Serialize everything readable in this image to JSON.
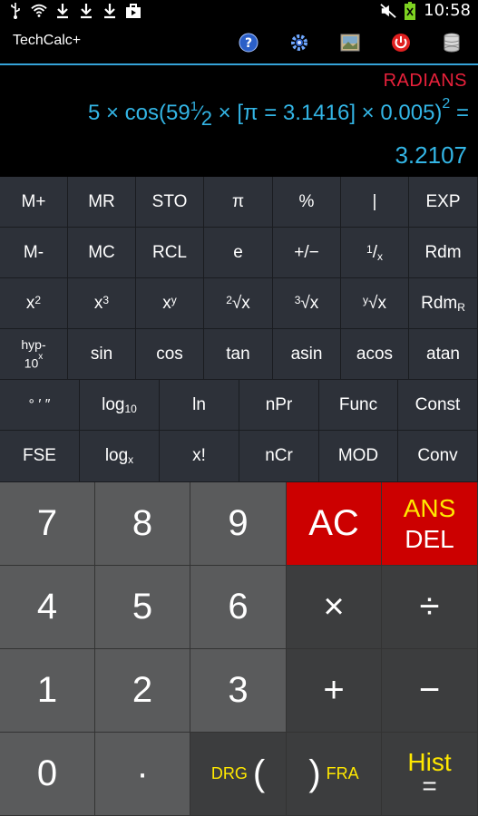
{
  "status_bar": {
    "time": "10:58",
    "left_icons": [
      "usb-icon",
      "wifi-icon",
      "download-icon",
      "download-icon",
      "download-icon",
      "shop-icon"
    ],
    "right_icons": [
      "mute-icon",
      "battery-icon"
    ]
  },
  "action_bar": {
    "title": "TechCalc+",
    "icons": [
      "help-icon",
      "settings-icon",
      "theme-icon",
      "power-icon",
      "storage-icon"
    ]
  },
  "display": {
    "mode": "RADIANS",
    "expression": {
      "prefix": "5 × cos(59",
      "frac_num": "1",
      "frac_slash": "⁄",
      "frac_den": "2",
      "middle": " × [π = 3.1416] × 0.005)",
      "exponent": "2",
      "suffix": " ="
    },
    "result": "3.2107"
  },
  "sci_keys": {
    "row1": [
      "M+",
      "MR",
      "STO",
      "π",
      "%",
      "|",
      "EXP"
    ],
    "row2": [
      "M-",
      "MC",
      "RCL",
      "e",
      "+/−",
      "1/x",
      "Rdm"
    ],
    "row3": [
      "x2",
      "x3",
      "xy",
      "2√x",
      "3√x",
      "y√x",
      "RdmR"
    ],
    "row4": [
      "hyp-10x",
      "sin",
      "cos",
      "tan",
      "asin",
      "acos",
      "atan"
    ],
    "row5": [
      "° ′ ″",
      "log10",
      "ln",
      "nPr",
      "Func",
      "Const"
    ],
    "row6": [
      "FSE",
      "logx",
      "x!",
      "nCr",
      "MOD",
      "Conv"
    ],
    "labels": {
      "recip_sup": "1",
      "recip_sub": "x",
      "x": "x",
      "two": "2",
      "three": "3",
      "y": "y",
      "root": "√x",
      "yroot_pre": "y",
      "rdm": "Rdm",
      "rdm_sub": "R",
      "hyp": "hyp-",
      "ten": "10",
      "log": "log",
      "log_sub10": "10",
      "log_subx": "x"
    }
  },
  "pad": {
    "n7": "7",
    "n8": "8",
    "n9": "9",
    "ac": "AC",
    "ans": "ANS",
    "del": "DEL",
    "n4": "4",
    "n5": "5",
    "n6": "6",
    "mul": "×",
    "div": "÷",
    "n1": "1",
    "n2": "2",
    "n3": "3",
    "plus": "+",
    "minus": "−",
    "n0": "0",
    "dot": "·",
    "drg": "DRG",
    "lparen": "(",
    "rparen": ")",
    "fra": "FRA",
    "hist": "Hist",
    "eq": "="
  },
  "colors": {
    "accent": "#33b5e5",
    "mode": "#e8213b",
    "ac_bg": "#cc0000",
    "yellow": "#ffe800"
  }
}
